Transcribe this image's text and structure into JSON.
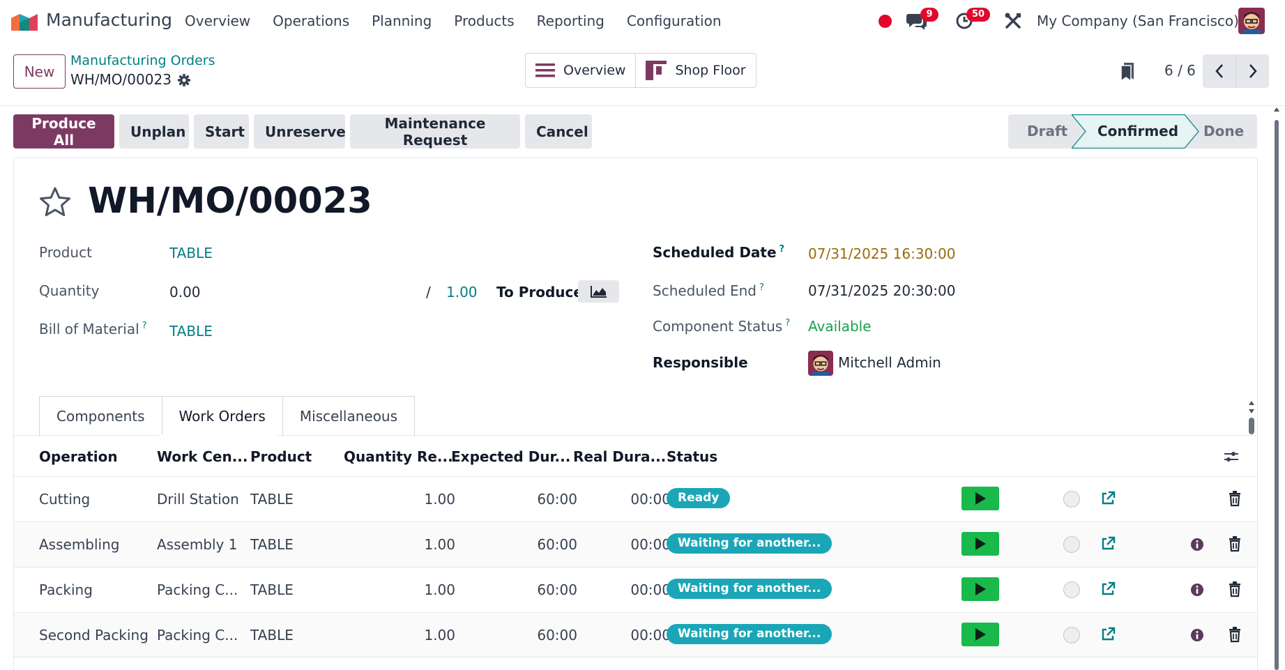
{
  "navbar": {
    "app_name": "Manufacturing",
    "menu": [
      "Overview",
      "Operations",
      "Planning",
      "Products",
      "Reporting",
      "Configuration"
    ],
    "chat_badge": "9",
    "activity_badge": "50",
    "company": "My Company (San Francisco)",
    "icons": [
      "manufacturing-logo-icon",
      "recording-dot-icon",
      "chat-icon",
      "clock-icon",
      "tools-icon",
      "avatar"
    ]
  },
  "control_panel": {
    "new_label": "New",
    "breadcrumb_parent": "Manufacturing Orders",
    "breadcrumb_current": "WH/MO/00023",
    "view_overview": "Overview",
    "view_shop_floor": "Shop Floor",
    "pager": "6 / 6"
  },
  "statusbar": {
    "actions": [
      "Produce All",
      "Unplan",
      "Start",
      "Unreserve",
      "Maintenance Request",
      "Cancel"
    ],
    "stages": [
      "Draft",
      "Confirmed",
      "Done"
    ],
    "current_stage": "Confirmed"
  },
  "form": {
    "title": "WH/MO/00023",
    "product_label": "Product",
    "product_value": "TABLE",
    "quantity_label": "Quantity",
    "quantity_value": "0.00",
    "quantity_sep": "/",
    "quantity_target": "1.00",
    "to_produce_label": "To Produce",
    "bom_label": "Bill of Material",
    "bom_value": "TABLE",
    "help_mark": "?",
    "scheduled_date_label": "Scheduled Date",
    "scheduled_date_value": "07/31/2025 16:30:00",
    "scheduled_end_label": "Scheduled End",
    "scheduled_end_value": "07/31/2025 20:30:00",
    "component_status_label": "Component Status",
    "component_status_value": "Available",
    "responsible_label": "Responsible",
    "responsible_value": "Mitchell Admin"
  },
  "tabs": [
    "Components",
    "Work Orders",
    "Miscellaneous"
  ],
  "active_tab": "Work Orders",
  "table": {
    "headers": [
      "Operation",
      "Work Cen...",
      "Product",
      "Quantity Re...",
      "Expected Dur...",
      "Real Dura...",
      "Status"
    ],
    "rows": [
      {
        "operation": "Cutting",
        "work_center": "Drill Station",
        "product": "TABLE",
        "quantity": "1.00",
        "expected": "60:00",
        "real": "00:00",
        "status": "Ready",
        "info": false
      },
      {
        "operation": "Assembling",
        "work_center": "Assembly 1",
        "product": "TABLE",
        "quantity": "1.00",
        "expected": "60:00",
        "real": "00:00",
        "status": "Waiting for another...",
        "info": true
      },
      {
        "operation": "Packing",
        "work_center": "Packing C...",
        "product": "TABLE",
        "quantity": "1.00",
        "expected": "60:00",
        "real": "00:00",
        "status": "Waiting for another...",
        "info": true
      },
      {
        "operation": "Second Packing",
        "work_center": "Packing C...",
        "product": "TABLE",
        "quantity": "1.00",
        "expected": "60:00",
        "real": "00:00",
        "status": "Waiting for another...",
        "info": true
      }
    ]
  },
  "colors": {
    "brand": "#7c3a63",
    "link": "#017e84",
    "ready_pill": "#1aa6b7",
    "play": "#19b94c",
    "badge": "#e0092b"
  }
}
